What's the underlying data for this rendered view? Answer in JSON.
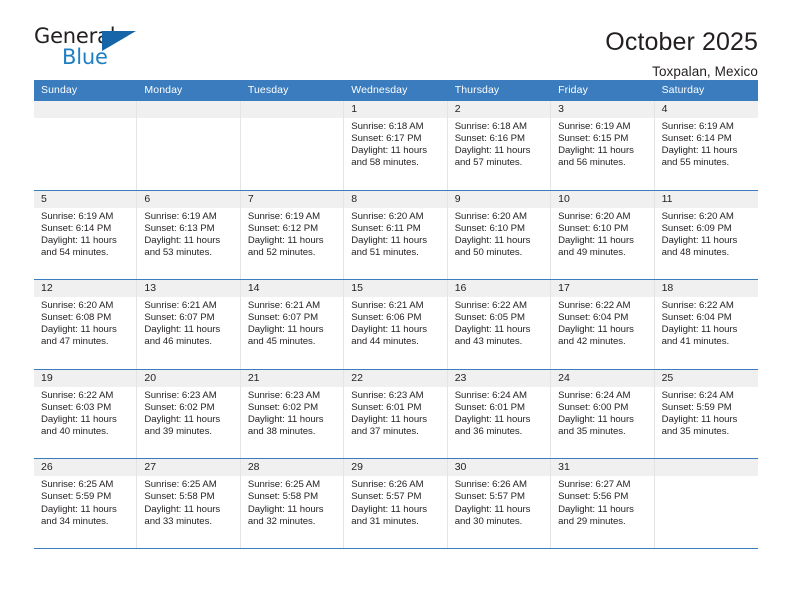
{
  "brand": {
    "name_top": "General",
    "name_bottom": "Blue",
    "triangle_color": "#1565a8",
    "blue_color": "#1f7fc4"
  },
  "header": {
    "title": "October 2025",
    "subtitle": "Toxpalan, Mexico",
    "accent_color": "#3a7cbe",
    "daystrip_color": "#f0f0f0"
  },
  "calendar": {
    "weekdays": [
      "Sunday",
      "Monday",
      "Tuesday",
      "Wednesday",
      "Thursday",
      "Friday",
      "Saturday"
    ],
    "weeks": [
      [
        {
          "day": "",
          "text": ""
        },
        {
          "day": "",
          "text": ""
        },
        {
          "day": "",
          "text": ""
        },
        {
          "day": "1",
          "text": "Sunrise: 6:18 AM\nSunset: 6:17 PM\nDaylight: 11 hours\nand 58 minutes."
        },
        {
          "day": "2",
          "text": "Sunrise: 6:18 AM\nSunset: 6:16 PM\nDaylight: 11 hours\nand 57 minutes."
        },
        {
          "day": "3",
          "text": "Sunrise: 6:19 AM\nSunset: 6:15 PM\nDaylight: 11 hours\nand 56 minutes."
        },
        {
          "day": "4",
          "text": "Sunrise: 6:19 AM\nSunset: 6:14 PM\nDaylight: 11 hours\nand 55 minutes."
        }
      ],
      [
        {
          "day": "5",
          "text": "Sunrise: 6:19 AM\nSunset: 6:14 PM\nDaylight: 11 hours\nand 54 minutes."
        },
        {
          "day": "6",
          "text": "Sunrise: 6:19 AM\nSunset: 6:13 PM\nDaylight: 11 hours\nand 53 minutes."
        },
        {
          "day": "7",
          "text": "Sunrise: 6:19 AM\nSunset: 6:12 PM\nDaylight: 11 hours\nand 52 minutes."
        },
        {
          "day": "8",
          "text": "Sunrise: 6:20 AM\nSunset: 6:11 PM\nDaylight: 11 hours\nand 51 minutes."
        },
        {
          "day": "9",
          "text": "Sunrise: 6:20 AM\nSunset: 6:10 PM\nDaylight: 11 hours\nand 50 minutes."
        },
        {
          "day": "10",
          "text": "Sunrise: 6:20 AM\nSunset: 6:10 PM\nDaylight: 11 hours\nand 49 minutes."
        },
        {
          "day": "11",
          "text": "Sunrise: 6:20 AM\nSunset: 6:09 PM\nDaylight: 11 hours\nand 48 minutes."
        }
      ],
      [
        {
          "day": "12",
          "text": "Sunrise: 6:20 AM\nSunset: 6:08 PM\nDaylight: 11 hours\nand 47 minutes."
        },
        {
          "day": "13",
          "text": "Sunrise: 6:21 AM\nSunset: 6:07 PM\nDaylight: 11 hours\nand 46 minutes."
        },
        {
          "day": "14",
          "text": "Sunrise: 6:21 AM\nSunset: 6:07 PM\nDaylight: 11 hours\nand 45 minutes."
        },
        {
          "day": "15",
          "text": "Sunrise: 6:21 AM\nSunset: 6:06 PM\nDaylight: 11 hours\nand 44 minutes."
        },
        {
          "day": "16",
          "text": "Sunrise: 6:22 AM\nSunset: 6:05 PM\nDaylight: 11 hours\nand 43 minutes."
        },
        {
          "day": "17",
          "text": "Sunrise: 6:22 AM\nSunset: 6:04 PM\nDaylight: 11 hours\nand 42 minutes."
        },
        {
          "day": "18",
          "text": "Sunrise: 6:22 AM\nSunset: 6:04 PM\nDaylight: 11 hours\nand 41 minutes."
        }
      ],
      [
        {
          "day": "19",
          "text": "Sunrise: 6:22 AM\nSunset: 6:03 PM\nDaylight: 11 hours\nand 40 minutes."
        },
        {
          "day": "20",
          "text": "Sunrise: 6:23 AM\nSunset: 6:02 PM\nDaylight: 11 hours\nand 39 minutes."
        },
        {
          "day": "21",
          "text": "Sunrise: 6:23 AM\nSunset: 6:02 PM\nDaylight: 11 hours\nand 38 minutes."
        },
        {
          "day": "22",
          "text": "Sunrise: 6:23 AM\nSunset: 6:01 PM\nDaylight: 11 hours\nand 37 minutes."
        },
        {
          "day": "23",
          "text": "Sunrise: 6:24 AM\nSunset: 6:01 PM\nDaylight: 11 hours\nand 36 minutes."
        },
        {
          "day": "24",
          "text": "Sunrise: 6:24 AM\nSunset: 6:00 PM\nDaylight: 11 hours\nand 35 minutes."
        },
        {
          "day": "25",
          "text": "Sunrise: 6:24 AM\nSunset: 5:59 PM\nDaylight: 11 hours\nand 35 minutes."
        }
      ],
      [
        {
          "day": "26",
          "text": "Sunrise: 6:25 AM\nSunset: 5:59 PM\nDaylight: 11 hours\nand 34 minutes."
        },
        {
          "day": "27",
          "text": "Sunrise: 6:25 AM\nSunset: 5:58 PM\nDaylight: 11 hours\nand 33 minutes."
        },
        {
          "day": "28",
          "text": "Sunrise: 6:25 AM\nSunset: 5:58 PM\nDaylight: 11 hours\nand 32 minutes."
        },
        {
          "day": "29",
          "text": "Sunrise: 6:26 AM\nSunset: 5:57 PM\nDaylight: 11 hours\nand 31 minutes."
        },
        {
          "day": "30",
          "text": "Sunrise: 6:26 AM\nSunset: 5:57 PM\nDaylight: 11 hours\nand 30 minutes."
        },
        {
          "day": "31",
          "text": "Sunrise: 6:27 AM\nSunset: 5:56 PM\nDaylight: 11 hours\nand 29 minutes."
        },
        {
          "day": "",
          "text": ""
        }
      ]
    ]
  }
}
